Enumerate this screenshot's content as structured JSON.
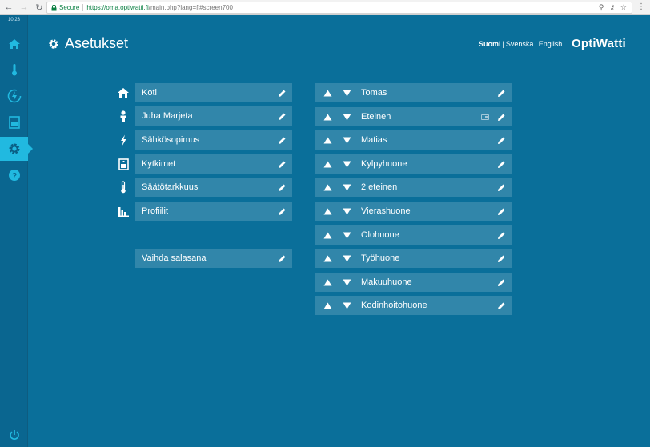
{
  "browser": {
    "secure_label": "Secure",
    "url_domain": "https://oma.optiwatti.fi",
    "url_path": "/main.php?lang=fi#screen700"
  },
  "rail": {
    "clock": "10:23"
  },
  "header": {
    "title": "Asetukset",
    "langs": [
      "Suomi",
      "Svenska",
      "English"
    ],
    "logo": "OptiWatti"
  },
  "settings": [
    {
      "label": "Koti",
      "icon": "home-icon"
    },
    {
      "label": "Juha Marjeta",
      "icon": "person-icon"
    },
    {
      "label": "Sähkösopimus",
      "icon": "lightning-icon"
    },
    {
      "label": "Kytkimet",
      "icon": "switch-icon"
    },
    {
      "label": "Säätötarkkuus",
      "icon": "thermometer-icon"
    },
    {
      "label": "Profiilit",
      "icon": "bar-chart-icon"
    }
  ],
  "password": {
    "label": "Vaihda salasana"
  },
  "rooms": [
    {
      "label": "Tomas"
    },
    {
      "label": "Eteinen"
    },
    {
      "label": "Matias"
    },
    {
      "label": "Kylpyhuone"
    },
    {
      "label": "2 eteinen"
    },
    {
      "label": "Vierashuone"
    },
    {
      "label": "Olohuone"
    },
    {
      "label": "Työhuone"
    },
    {
      "label": "Makuuhuone"
    },
    {
      "label": "Kodinhoitohuone"
    }
  ]
}
